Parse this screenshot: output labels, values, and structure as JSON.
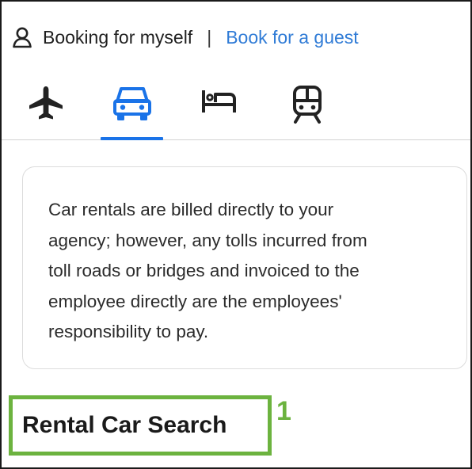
{
  "booking": {
    "self_label": "Booking for myself",
    "separator": "|",
    "guest_link": "Book for a guest"
  },
  "tabs": [
    {
      "id": "flights",
      "icon": "airplane-icon",
      "active": false
    },
    {
      "id": "cars",
      "icon": "car-icon",
      "active": true
    },
    {
      "id": "hotels",
      "icon": "bed-icon",
      "active": false
    },
    {
      "id": "trains",
      "icon": "train-icon",
      "active": false
    }
  ],
  "notice": {
    "text": "Car rentals are billed directly to your\nagency; however, any tolls incurred from\ntoll roads or bridges and invoiced to the\nemployee directly are the employees'\nresponsibility to pay."
  },
  "section": {
    "title": "Rental Car Search"
  },
  "callout": {
    "number": "1",
    "color": "#6cb33f"
  },
  "colors": {
    "accent": "#1a73e8",
    "link": "#2f7bd6",
    "icon_dark": "#222222"
  }
}
